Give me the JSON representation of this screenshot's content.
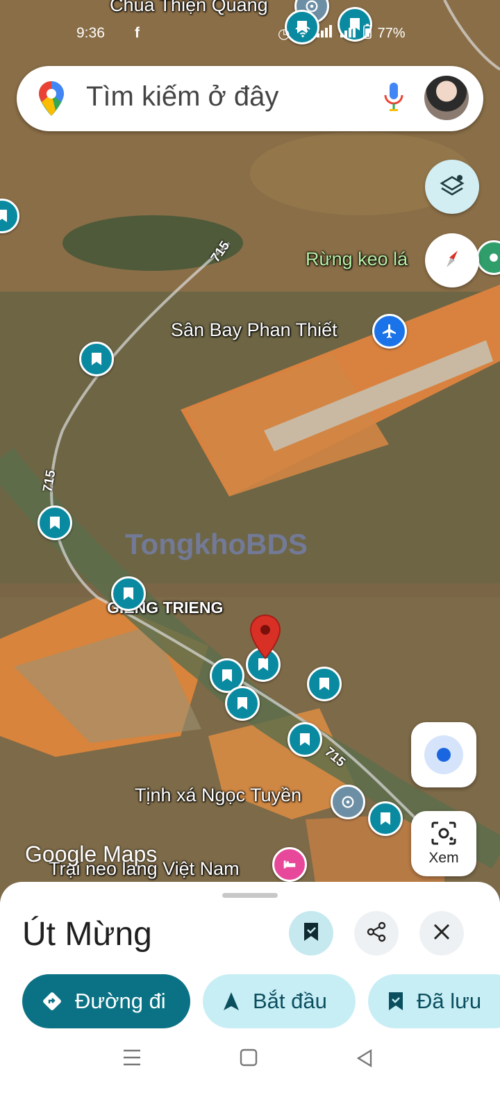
{
  "status_bar": {
    "time": "9:36",
    "app_icon": "facebook-icon",
    "battery": "77%"
  },
  "search": {
    "placeholder": "Tìm kiếm ở đây"
  },
  "map": {
    "labels": {
      "temple_top": "Chùa Thiện Quang",
      "forest": "Rừng keo lá",
      "airport": "Sân Bay Phan Thiết",
      "village": "GIẾNG TRIENG",
      "monastery": "Tịnh xá Ngọc Tuyền",
      "camp": "Trại neo lang Việt Nam"
    },
    "roads": [
      "715",
      "715",
      "715"
    ],
    "watermark": "TongkhoBDS",
    "google_logo": "Google Maps"
  },
  "controls": {
    "lens_label": "Xem"
  },
  "sheet": {
    "title": "Út Mừng",
    "buttons": {
      "directions": "Đường đi",
      "start": "Bắt đầu",
      "saved": "Đã lưu"
    }
  },
  "colors": {
    "accent": "#0b7285",
    "marker": "#0a8aa0",
    "pin": "#d93025"
  }
}
